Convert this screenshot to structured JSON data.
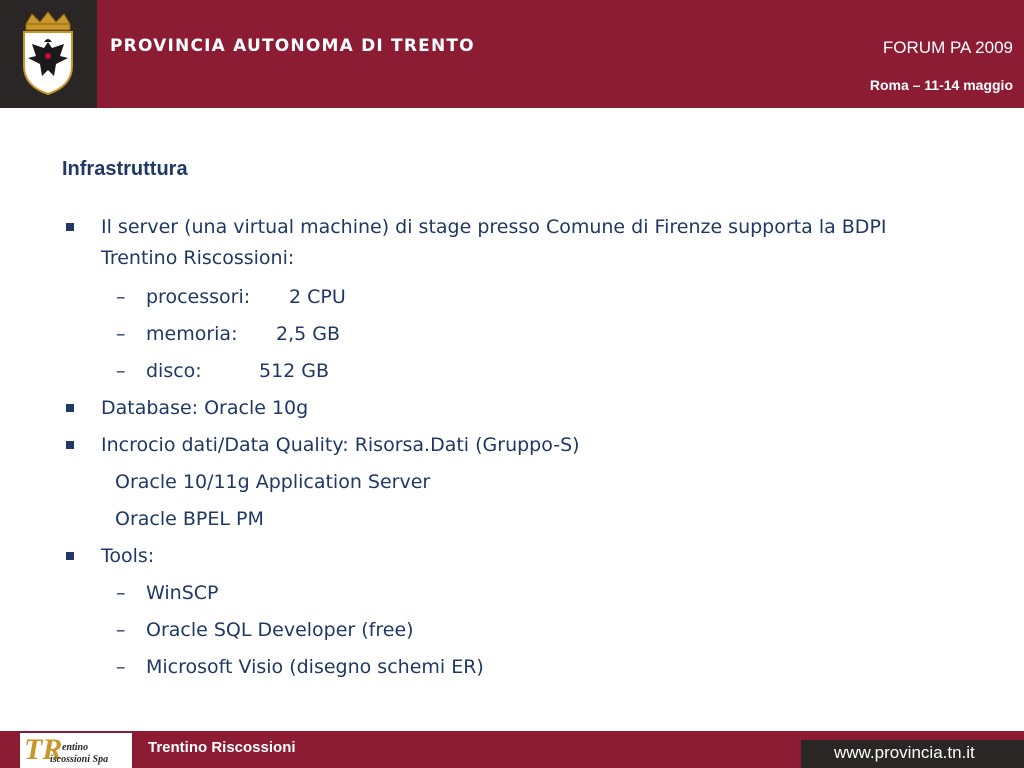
{
  "header": {
    "organization": "PROVINCIA AUTONOMA DI TRENTO",
    "event_title": "FORUM PA 2009",
    "event_date": "Roma – 11-14 maggio",
    "crest_icon": "crest-icon"
  },
  "slide": {
    "title": "Infrastruttura",
    "server_line1": "Il server (una virtual machine) di stage presso Comune di Firenze supporta la BDPI",
    "server_line2": "Trentino Riscossioni:",
    "cpu_label": "processori:",
    "cpu_value": "2 CPU",
    "mem_label": "memoria:",
    "mem_value": "2,5 GB",
    "disk_label": "disco:",
    "disk_value": "512 GB",
    "database": "Database: Oracle 10g",
    "incrocio": "Incrocio dati/Data Quality: Risorsa.Dati (Gruppo-S)",
    "app_server": "Oracle 10/11g Application Server",
    "bpel": "Oracle BPEL PM",
    "tools": "Tools:",
    "tool1": "WinSCP",
    "tool2": "Oracle SQL Developer (free)",
    "tool3": "Microsoft Visio (disegno schemi ER)",
    "dash": "–"
  },
  "footer": {
    "logo_letter": "TR",
    "logo_line1": "entino",
    "logo_line2": "iscossioni Spa",
    "company": "Trentino Riscossioni",
    "url": "www.provincia.tn.it"
  },
  "colors": {
    "header_bg": "#8b1c34",
    "dark_box": "#2b2626",
    "text_blue": "#1f3864"
  }
}
